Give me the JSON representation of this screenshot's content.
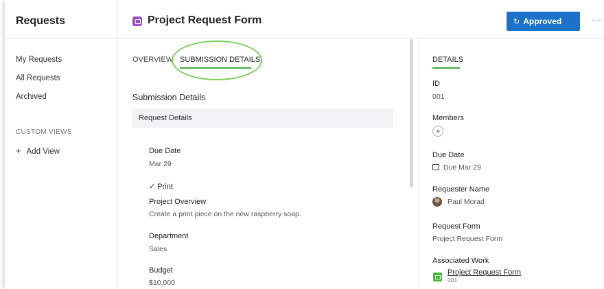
{
  "sidebar": {
    "title": "Requests",
    "items": [
      {
        "label": "My Requests"
      },
      {
        "label": "All Requests"
      },
      {
        "label": "Archived"
      }
    ],
    "custom_views_label": "CUSTOM VIEWS",
    "add_view_label": "Add View",
    "add_view_icon": "+"
  },
  "header": {
    "icon": "form-icon",
    "title": "Project Request Form",
    "status_button": "Approved",
    "status_icon": "↻",
    "more_label": "···",
    "accent_color": "#1a73c8"
  },
  "main": {
    "tabs": [
      {
        "label": "OVERVIEW",
        "active": false
      },
      {
        "label": "SUBMISSION DETAILS",
        "active": true
      }
    ],
    "section_title": "Submission Details",
    "details_bar": "Request Details",
    "fields": {
      "due_date": {
        "label": "Due Date",
        "value": "Mar 29"
      },
      "print_check": "✓ Print",
      "project_overview": {
        "label": "Project Overview",
        "value": "Create a print piece on the new raspberry soap."
      },
      "department": {
        "label": "Department",
        "value": "Sales"
      },
      "budget": {
        "label": "Budget",
        "value": "$10,000"
      }
    }
  },
  "details_panel": {
    "tab": "DETAILS",
    "id": {
      "label": "ID",
      "value": "001"
    },
    "members": {
      "label": "Members",
      "add_icon": "+"
    },
    "due_date": {
      "label": "Due Date",
      "value": "Due Mar 29"
    },
    "requester": {
      "label": "Requester Name",
      "value": "Paul Morad"
    },
    "request_form": {
      "label": "Request Form",
      "value": "Project Request Form"
    },
    "associated_work": {
      "label": "Associated Work",
      "link": "Project Request Form",
      "id": "001"
    }
  },
  "colors": {
    "tab_underline": "#3daa3a",
    "highlight": "#7ccf5a",
    "form_icon": "#9a52c5",
    "work_icon": "#42b93a"
  }
}
